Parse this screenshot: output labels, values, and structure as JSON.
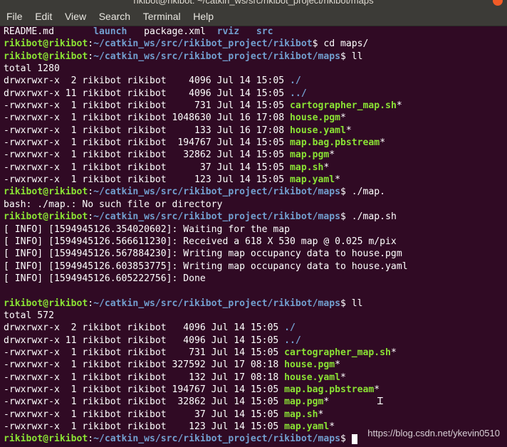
{
  "window": {
    "title": "rikibot@rikibot: ~/catkin_ws/src/rikibot_project/rikibot/maps"
  },
  "menu": [
    "File",
    "Edit",
    "View",
    "Search",
    "Terminal",
    "Help"
  ],
  "watermark": "https://blog.csdn.net/ykevin0510",
  "terminal": {
    "lines": [
      [
        {
          "t": "README.md       ",
          "c": ""
        },
        {
          "t": "launch",
          "c": "dir"
        },
        {
          "t": "   ",
          "c": ""
        },
        {
          "t": "package.xml",
          "c": ""
        },
        {
          "t": "  ",
          "c": ""
        },
        {
          "t": "rviz",
          "c": "dir"
        },
        {
          "t": "   ",
          "c": ""
        },
        {
          "t": "src",
          "c": "dir"
        }
      ],
      [
        {
          "t": "rikibot@rikibot",
          "c": "prompt"
        },
        {
          "t": ":",
          "c": ""
        },
        {
          "t": "~/catkin_ws/src/rikibot_project/rikibot",
          "c": "path"
        },
        {
          "t": "$ cd maps/",
          "c": ""
        }
      ],
      [
        {
          "t": "rikibot@rikibot",
          "c": "prompt"
        },
        {
          "t": ":",
          "c": ""
        },
        {
          "t": "~/catkin_ws/src/rikibot_project/rikibot/maps",
          "c": "path"
        },
        {
          "t": "$ ll",
          "c": ""
        }
      ],
      [
        {
          "t": "total 1280",
          "c": ""
        }
      ],
      [
        {
          "t": "drwxrwxr-x  2 rikibot rikibot    4096 Jul 14 15:05 ",
          "c": ""
        },
        {
          "t": "./",
          "c": "dir"
        }
      ],
      [
        {
          "t": "drwxrwxr-x 11 rikibot rikibot    4096 Jul 14 15:05 ",
          "c": ""
        },
        {
          "t": "../",
          "c": "dir"
        }
      ],
      [
        {
          "t": "-rwxrwxr-x  1 rikibot rikibot     731 Jul 14 15:05 ",
          "c": ""
        },
        {
          "t": "cartographer_map.sh",
          "c": "exec"
        },
        {
          "t": "*",
          "c": ""
        }
      ],
      [
        {
          "t": "-rwxrwxr-x  1 rikibot rikibot 1048630 Jul 16 17:08 ",
          "c": ""
        },
        {
          "t": "house.pgm",
          "c": "exec"
        },
        {
          "t": "*",
          "c": ""
        }
      ],
      [
        {
          "t": "-rwxrwxr-x  1 rikibot rikibot     133 Jul 16 17:08 ",
          "c": ""
        },
        {
          "t": "house.yaml",
          "c": "exec"
        },
        {
          "t": "*",
          "c": ""
        }
      ],
      [
        {
          "t": "-rwxrwxr-x  1 rikibot rikibot  194767 Jul 14 15:05 ",
          "c": ""
        },
        {
          "t": "map.bag.pbstream",
          "c": "exec"
        },
        {
          "t": "*",
          "c": ""
        }
      ],
      [
        {
          "t": "-rwxrwxr-x  1 rikibot rikibot   32862 Jul 14 15:05 ",
          "c": ""
        },
        {
          "t": "map.pgm",
          "c": "exec"
        },
        {
          "t": "*",
          "c": ""
        }
      ],
      [
        {
          "t": "-rwxrwxr-x  1 rikibot rikibot      37 Jul 14 15:05 ",
          "c": ""
        },
        {
          "t": "map.sh",
          "c": "exec"
        },
        {
          "t": "*",
          "c": ""
        }
      ],
      [
        {
          "t": "-rwxrwxr-x  1 rikibot rikibot     123 Jul 14 15:05 ",
          "c": ""
        },
        {
          "t": "map.yaml",
          "c": "exec"
        },
        {
          "t": "*",
          "c": ""
        }
      ],
      [
        {
          "t": "rikibot@rikibot",
          "c": "prompt"
        },
        {
          "t": ":",
          "c": ""
        },
        {
          "t": "~/catkin_ws/src/rikibot_project/rikibot/maps",
          "c": "path"
        },
        {
          "t": "$ ./map.",
          "c": ""
        }
      ],
      [
        {
          "t": "bash: ./map.: No such file or directory",
          "c": ""
        }
      ],
      [
        {
          "t": "rikibot@rikibot",
          "c": "prompt"
        },
        {
          "t": ":",
          "c": ""
        },
        {
          "t": "~/catkin_ws/src/rikibot_project/rikibot/maps",
          "c": "path"
        },
        {
          "t": "$ ./map.sh",
          "c": ""
        }
      ],
      [
        {
          "t": "[ INFO] [1594945126.354020602]: Waiting for the map",
          "c": ""
        }
      ],
      [
        {
          "t": "[ INFO] [1594945126.566611230]: Received a 618 X 530 map @ 0.025 m/pix",
          "c": ""
        }
      ],
      [
        {
          "t": "[ INFO] [1594945126.567884230]: Writing map occupancy data to house.pgm",
          "c": ""
        }
      ],
      [
        {
          "t": "[ INFO] [1594945126.603853775]: Writing map occupancy data to house.yaml",
          "c": ""
        }
      ],
      [
        {
          "t": "[ INFO] [1594945126.605222756]: Done",
          "c": ""
        }
      ],
      [
        {
          "t": "",
          "c": ""
        }
      ],
      [
        {
          "t": "rikibot@rikibot",
          "c": "prompt"
        },
        {
          "t": ":",
          "c": ""
        },
        {
          "t": "~/catkin_ws/src/rikibot_project/rikibot/maps",
          "c": "path"
        },
        {
          "t": "$ ll",
          "c": ""
        }
      ],
      [
        {
          "t": "total 572",
          "c": ""
        }
      ],
      [
        {
          "t": "drwxrwxr-x  2 rikibot rikibot   4096 Jul 14 15:05 ",
          "c": ""
        },
        {
          "t": "./",
          "c": "dir"
        }
      ],
      [
        {
          "t": "drwxrwxr-x 11 rikibot rikibot   4096 Jul 14 15:05 ",
          "c": ""
        },
        {
          "t": "../",
          "c": "dir"
        }
      ],
      [
        {
          "t": "-rwxrwxr-x  1 rikibot rikibot    731 Jul 14 15:05 ",
          "c": ""
        },
        {
          "t": "cartographer_map.sh",
          "c": "exec"
        },
        {
          "t": "*",
          "c": ""
        }
      ],
      [
        {
          "t": "-rwxrwxr-x  1 rikibot rikibot 327592 Jul 17 08:18 ",
          "c": ""
        },
        {
          "t": "house.pgm",
          "c": "exec"
        },
        {
          "t": "*",
          "c": ""
        }
      ],
      [
        {
          "t": "-rwxrwxr-x  1 rikibot rikibot    132 Jul 17 08:18 ",
          "c": ""
        },
        {
          "t": "house.yaml",
          "c": "exec"
        },
        {
          "t": "*",
          "c": ""
        }
      ],
      [
        {
          "t": "-rwxrwxr-x  1 rikibot rikibot 194767 Jul 14 15:05 ",
          "c": ""
        },
        {
          "t": "map.bag.pbstream",
          "c": "exec"
        },
        {
          "t": "*",
          "c": ""
        }
      ],
      [
        {
          "t": "-rwxrwxr-x  1 rikibot rikibot  32862 Jul 14 15:05 ",
          "c": ""
        },
        {
          "t": "map.pgm",
          "c": "exec"
        },
        {
          "t": "*",
          "c": ""
        }
      ],
      [
        {
          "t": "-rwxrwxr-x  1 rikibot rikibot     37 Jul 14 15:05 ",
          "c": ""
        },
        {
          "t": "map.sh",
          "c": "exec"
        },
        {
          "t": "*",
          "c": ""
        }
      ],
      [
        {
          "t": "-rwxrwxr-x  1 rikibot rikibot    123 Jul 14 15:05 ",
          "c": ""
        },
        {
          "t": "map.yaml",
          "c": "exec"
        },
        {
          "t": "*",
          "c": ""
        }
      ],
      [
        {
          "t": "rikibot@rikibot",
          "c": "prompt"
        },
        {
          "t": ":",
          "c": ""
        },
        {
          "t": "~/catkin_ws/src/rikibot_project/rikibot/maps",
          "c": "path"
        },
        {
          "t": "$ ",
          "c": ""
        }
      ]
    ]
  }
}
